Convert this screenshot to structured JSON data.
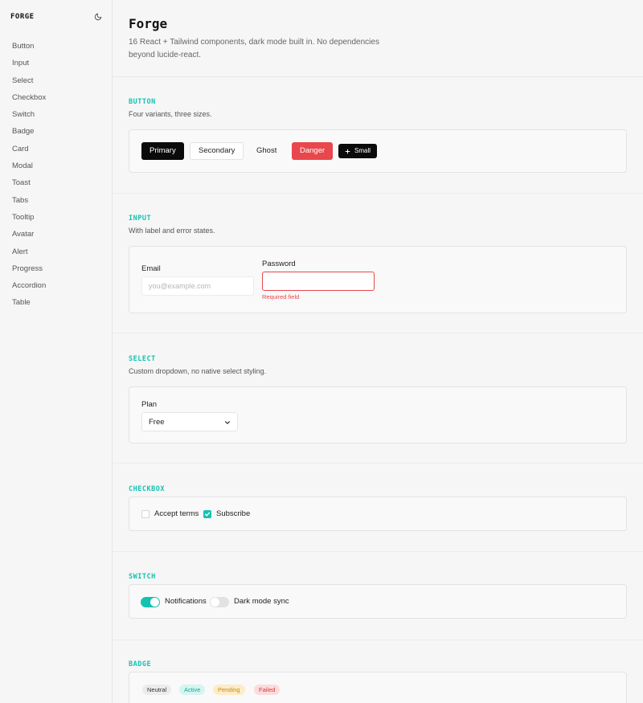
{
  "sidebar": {
    "brand": "FORGE",
    "theme_icon": "moon-icon",
    "items": [
      {
        "label": "Button"
      },
      {
        "label": "Input"
      },
      {
        "label": "Select"
      },
      {
        "label": "Checkbox"
      },
      {
        "label": "Switch"
      },
      {
        "label": "Badge"
      },
      {
        "label": "Card"
      },
      {
        "label": "Modal"
      },
      {
        "label": "Toast"
      },
      {
        "label": "Tabs"
      },
      {
        "label": "Tooltip"
      },
      {
        "label": "Avatar"
      },
      {
        "label": "Alert"
      },
      {
        "label": "Progress"
      },
      {
        "label": "Accordion"
      },
      {
        "label": "Table"
      }
    ]
  },
  "header": {
    "title": "Forge",
    "subtitle": "16 React + Tailwind components, dark mode built in. No dependencies beyond lucide-react."
  },
  "sections": {
    "button": {
      "title": "BUTTON",
      "desc": "Four variants, three sizes.",
      "primary": "Primary",
      "secondary": "Secondary",
      "ghost": "Ghost",
      "danger": "Danger",
      "small": "Small",
      "small_icon": "plus-icon"
    },
    "input": {
      "title": "INPUT",
      "desc": "With label and error states.",
      "email_label": "Email",
      "email_placeholder": "you@example.com",
      "email_value": "",
      "password_label": "Password",
      "password_value": "",
      "password_error": "Required field"
    },
    "select": {
      "title": "SELECT",
      "desc": "Custom dropdown, no native select styling.",
      "label": "Plan",
      "value": "Free",
      "chevron_icon": "chevron-down-icon"
    },
    "checkbox": {
      "title": "CHECKBOX",
      "accept_label": "Accept terms",
      "accept_checked": false,
      "subscribe_label": "Subscribe",
      "subscribe_checked": true
    },
    "switch": {
      "title": "SWITCH",
      "notifications_label": "Notifications",
      "notifications_on": true,
      "dark_sync_label": "Dark mode sync",
      "dark_sync_on": false
    },
    "badge": {
      "title": "BADGE",
      "neutral": "Neutral",
      "active": "Active",
      "pending": "Pending",
      "failed": "Failed"
    }
  },
  "colors": {
    "accent": "#14c2b2",
    "danger": "#e8474c",
    "primary": "#0b0b0b",
    "background": "#f6f6f6",
    "badge_neutral_bg": "#ececec",
    "badge_active_bg": "#d5f5f1",
    "badge_pending_bg": "#fdecc8",
    "badge_failed_bg": "#fbdcdd"
  }
}
